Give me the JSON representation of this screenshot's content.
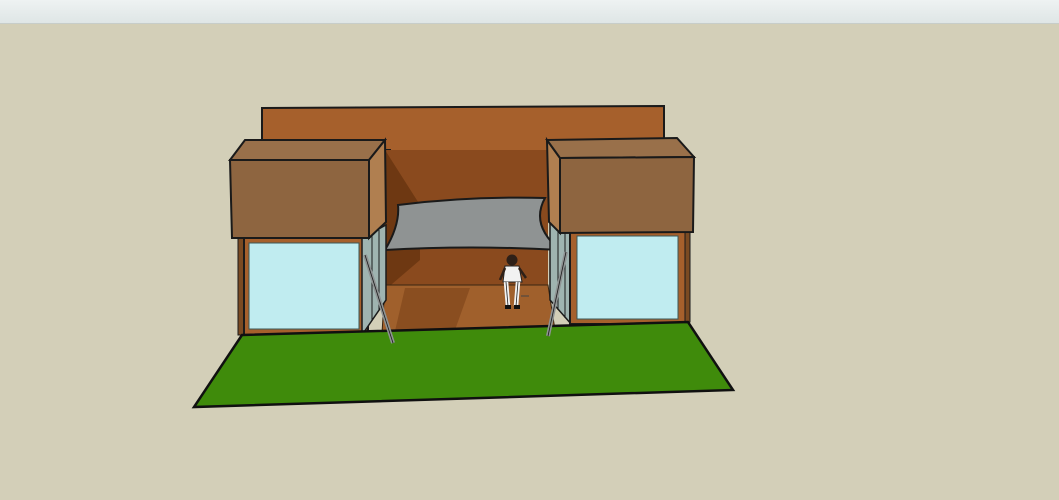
{
  "app": {
    "viewport_background": "#d3cfb8",
    "toolbar_color": "#e8eeee"
  },
  "scene": {
    "objects": [
      "back-wall",
      "left-pavilion",
      "right-pavilion",
      "shade-sail",
      "human-figure",
      "grass-lawn",
      "support-pole-left",
      "support-pole-right"
    ],
    "colors": {
      "wall": "#a6602c",
      "box_front": "#8e6540",
      "box_top": "#99704a",
      "glass": "#c0ecf0",
      "grass": "#3f8b0b",
      "floor": "#a0602c",
      "sail": "#8f9393"
    }
  }
}
